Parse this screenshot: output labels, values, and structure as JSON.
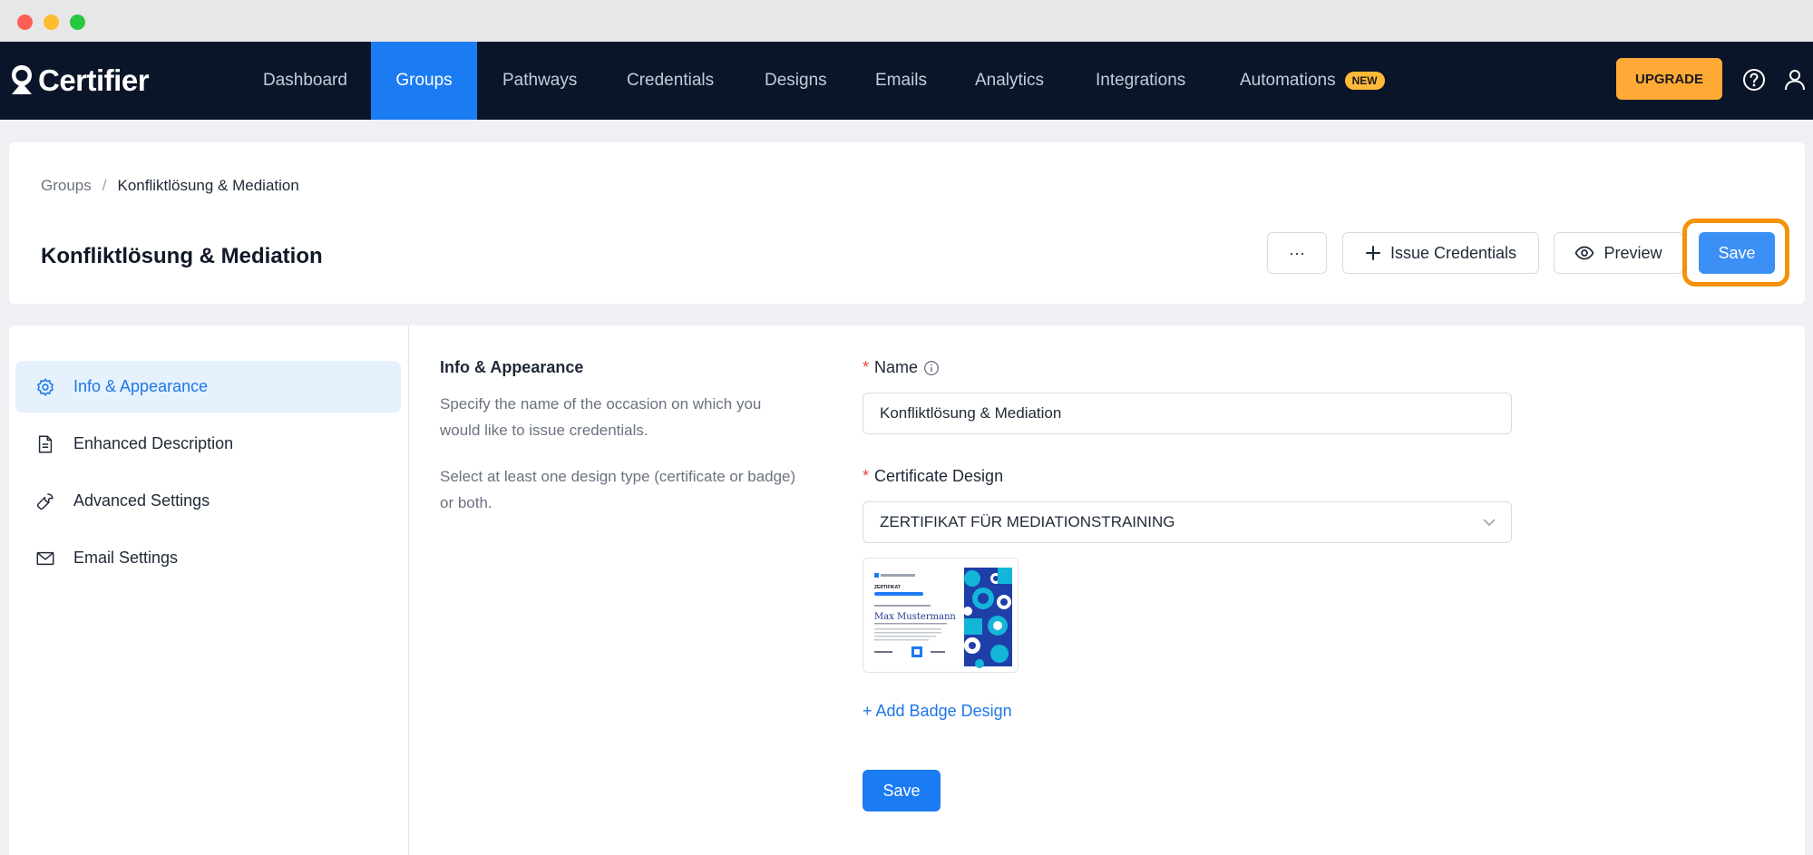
{
  "app": {
    "name": "Certifier"
  },
  "nav": {
    "items": [
      {
        "label": "Dashboard"
      },
      {
        "label": "Groups"
      },
      {
        "label": "Pathways"
      },
      {
        "label": "Credentials"
      },
      {
        "label": "Designs"
      },
      {
        "label": "Emails"
      },
      {
        "label": "Analytics"
      },
      {
        "label": "Integrations"
      },
      {
        "label": "Automations",
        "badge": "NEW"
      }
    ],
    "active": "Groups",
    "upgrade_label": "UPGRADE",
    "icons": [
      "help-circle-icon",
      "user-icon"
    ]
  },
  "breadcrumb": {
    "parent": "Groups",
    "separator": "/",
    "current": "Konfliktlösung & Mediation"
  },
  "header": {
    "title": "Konfliktlösung & Mediation",
    "more_label": "···",
    "issue_label": "Issue Credentials",
    "preview_label": "Preview",
    "save_label": "Save"
  },
  "sidebar": {
    "items": [
      {
        "label": "Info & Appearance",
        "icon": "gear-icon",
        "active": true
      },
      {
        "label": "Enhanced Description",
        "icon": "document-icon"
      },
      {
        "label": "Advanced Settings",
        "icon": "wrench-icon"
      },
      {
        "label": "Email Settings",
        "icon": "mail-icon"
      }
    ]
  },
  "section": {
    "title": "Info & Appearance",
    "desc1": "Specify the name of the occasion on which you would like to issue credentials.",
    "desc2": "Select at least one design type (certificate or badge) or both."
  },
  "form": {
    "required_mark": "*",
    "name_label": "Name",
    "name_value": "Konfliktlösung & Mediation",
    "design_label": "Certificate Design",
    "design_value": "ZERTIFIKAT FÜR MEDIATIONSTRAINING",
    "certificate_preview": {
      "heading": "ZERTIFIKAT",
      "recipient": "Max Mustermann"
    },
    "add_badge_label": "+ Add Badge Design",
    "save_label": "Save"
  },
  "colors": {
    "nav_bg": "#0b1529",
    "accent": "#1b7bf3",
    "upgrade": "#ffaa37",
    "highlight": "#f59208",
    "new_badge": "#ffb938"
  }
}
